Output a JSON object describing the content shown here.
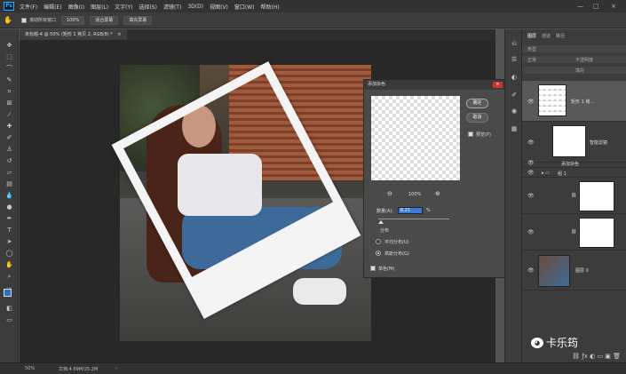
{
  "app": {
    "logo": "Ps"
  },
  "menu": [
    "文件(F)",
    "编辑(E)",
    "图像(I)",
    "图层(L)",
    "文字(Y)",
    "选择(S)",
    "滤镜(T)",
    "3D(D)",
    "视图(V)",
    "窗口(W)",
    "帮助(H)"
  ],
  "window_controls": {
    "minimize": "—",
    "maximize": "□",
    "close": "×"
  },
  "options_bar": {
    "checkbox_label": "滚动所有窗口",
    "zoom": "100%",
    "fit_screen": "适合屏幕",
    "fill_screen": "填充屏幕"
  },
  "document_tab": {
    "title": "未标题-4 @ 50% (矩形 1 拷贝 2, RGB/8) *",
    "close": "×"
  },
  "dialog": {
    "title": "添加杂色",
    "close": "×",
    "ok": "确定",
    "cancel": "取消",
    "preview_label": "预览(P)",
    "zoom": "100%",
    "zoom_out": "⊖",
    "zoom_in": "⊕",
    "amount_label": "数量(A):",
    "amount_value": "6.21",
    "amount_unit": "%",
    "distribution_label": "分布",
    "uniform_label": "平均分布(U)",
    "gaussian_label": "高斯分布(G)",
    "mono_label": "单色(M)"
  },
  "panel": {
    "tabs": [
      "图层",
      "通道",
      "路径"
    ],
    "kind_filter": "类型",
    "blend_mode": "正常",
    "opacity": "不透明度",
    "fill": "填充",
    "layers": [
      {
        "name": "矩形 1 拷..."
      },
      {
        "name": "智能滤镜"
      },
      {
        "name": "添加杂色"
      },
      {
        "name": "组 1"
      },
      {
        "name": ""
      },
      {
        "name": ""
      },
      {
        "name": "图层 0"
      }
    ]
  },
  "status": {
    "zoom": "50%",
    "doc": "文档:4.69M/25.2M",
    "arrow": "›"
  },
  "watermark": {
    "text": "卡乐筠",
    "icon": "wechat-icon"
  }
}
